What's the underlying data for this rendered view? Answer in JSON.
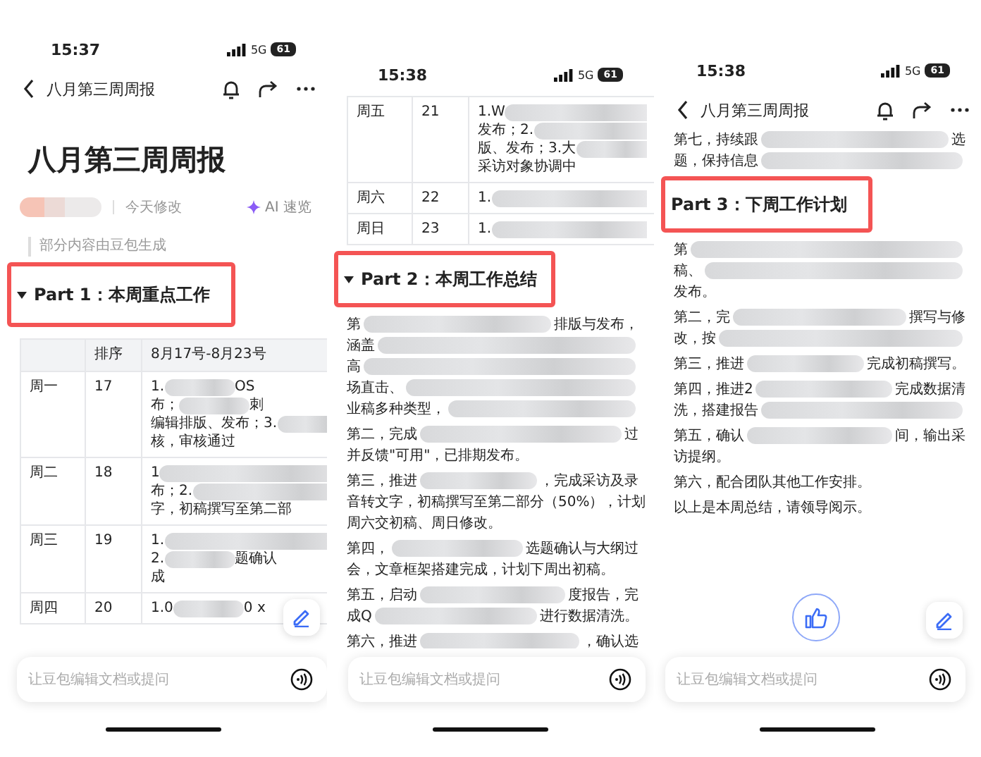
{
  "screens": [
    {
      "status_bar": {
        "time": "15:37",
        "network": "5G",
        "battery": "61"
      },
      "nav_bar": {
        "title": "八月第三周周报"
      },
      "document": {
        "title": "八月第三周周报",
        "modified": "今天修改",
        "ai_button": "AI 速览",
        "note": "部分内容由豆包生成"
      },
      "blocks": [
        {
          "kind": "heading",
          "text": "Part 1：本周重点工作",
          "collapsible": true,
          "highlighted": true
        },
        {
          "kind": "table",
          "columns": [
            "排序",
            "8月17号-8月23号"
          ],
          "rows": [
            {
              "day": "周一",
              "number": "17",
              "lines": [
                [
                  {
                    "kind": "text",
                    "text": "1."
                  },
                  {
                    "kind": "blur"
                  },
                  {
                    "kind": "text",
                    "text": "OS"
                  }
                ],
                [
                  {
                    "kind": "text",
                    "text": "布；"
                  },
                  {
                    "kind": "blur"
                  },
                  {
                    "kind": "text",
                    "text": "刺"
                  }
                ],
                [
                  {
                    "kind": "text",
                    "text": "编辑排版、发布；3."
                  },
                  {
                    "kind": "blur"
                  }
                ],
                [
                  {
                    "kind": "text",
                    "text": "核，审核通过"
                  }
                ]
              ]
            },
            {
              "day": "周二",
              "number": "18",
              "lines": [
                [
                  {
                    "kind": "text",
                    "text": "1"
                  },
                  {
                    "kind": "blur"
                  }
                ],
                [
                  {
                    "kind": "text",
                    "text": "布；2."
                  },
                  {
                    "kind": "blur"
                  }
                ],
                [
                  {
                    "kind": "text",
                    "text": "字，初稿撰写至第二部"
                  }
                ]
              ]
            },
            {
              "day": "周三",
              "number": "19",
              "lines": [
                [
                  {
                    "kind": "text",
                    "text": "1."
                  },
                  {
                    "kind": "blur"
                  }
                ],
                [
                  {
                    "kind": "text",
                    "text": "2."
                  },
                  {
                    "kind": "blur"
                  },
                  {
                    "kind": "text",
                    "text": "题确认"
                  }
                ],
                [
                  {
                    "kind": "text",
                    "text": "成"
                  }
                ]
              ]
            },
            {
              "day": "周四",
              "number": "20",
              "lines": [
                [
                  {
                    "kind": "text",
                    "text": "1.0"
                  },
                  {
                    "kind": "blur"
                  },
                  {
                    "kind": "text",
                    "text": "0 x"
                  }
                ]
              ]
            }
          ]
        }
      ],
      "edit_button": true,
      "input": {
        "placeholder": "让豆包编辑文档或提问"
      }
    },
    {
      "status_bar": {
        "time": "15:38",
        "network": "5G",
        "battery": "61"
      },
      "blocks": [
        {
          "kind": "table",
          "rows": [
            {
              "day": "周五",
              "number": "21",
              "lines": [
                [
                  {
                    "kind": "text",
                    "text": "1.W"
                  },
                  {
                    "kind": "blur"
                  }
                ],
                [
                  {
                    "kind": "text",
                    "text": "发布；2."
                  },
                  {
                    "kind": "blur"
                  }
                ],
                [
                  {
                    "kind": "text",
                    "text": "版、发布；3.大"
                  },
                  {
                    "kind": "blur"
                  }
                ],
                [
                  {
                    "kind": "text",
                    "text": "采访对象协调中"
                  }
                ]
              ]
            },
            {
              "day": "周六",
              "number": "22",
              "lines": [
                [
                  {
                    "kind": "text",
                    "text": "1."
                  },
                  {
                    "kind": "blur"
                  }
                ]
              ]
            },
            {
              "day": "周日",
              "number": "23",
              "lines": [
                [
                  {
                    "kind": "text",
                    "text": "1."
                  },
                  {
                    "kind": "blur"
                  }
                ]
              ]
            }
          ]
        },
        {
          "kind": "heading",
          "text": "Part 2：本周工作总结",
          "collapsible": true,
          "highlighted": true
        },
        {
          "kind": "paragraph",
          "lines": [
            [
              {
                "kind": "text",
                "text": "第"
              },
              {
                "kind": "blur"
              },
              {
                "kind": "text",
                "text": "排版与发布，"
              }
            ],
            [
              {
                "kind": "text",
                "text": "涵盖"
              },
              {
                "kind": "blur"
              }
            ],
            [
              {
                "kind": "text",
                "text": "高"
              },
              {
                "kind": "blur"
              }
            ],
            [
              {
                "kind": "text",
                "text": "场直击、"
              },
              {
                "kind": "blur"
              }
            ],
            [
              {
                "kind": "text",
                "text": "业稿多种类型，"
              },
              {
                "kind": "blur"
              }
            ]
          ]
        },
        {
          "kind": "paragraph",
          "lines": [
            [
              {
                "kind": "text",
                "text": "第二，完成"
              },
              {
                "kind": "blur"
              },
              {
                "kind": "text",
                "text": "过"
              }
            ],
            [
              {
                "kind": "text",
                "text": "并反馈\"可用\"，已排期发布。"
              }
            ]
          ]
        },
        {
          "kind": "paragraph",
          "lines": [
            [
              {
                "kind": "text",
                "text": "第三，推进"
              },
              {
                "kind": "blur"
              },
              {
                "kind": "text",
                "text": "，完成采访及录"
              }
            ],
            [
              {
                "kind": "text",
                "text": "音转文字，初稿撰写至第二部分（50%），计划"
              }
            ],
            [
              {
                "kind": "text",
                "text": "周六交初稿、周日修改。"
              }
            ]
          ]
        },
        {
          "kind": "paragraph",
          "lines": [
            [
              {
                "kind": "text",
                "text": "第四，"
              },
              {
                "kind": "blur"
              },
              {
                "kind": "text",
                "text": "选题确认与大纲过"
              }
            ],
            [
              {
                "kind": "text",
                "text": "会，文章框架搭建完成，计划下周出初稿。"
              }
            ]
          ]
        },
        {
          "kind": "paragraph",
          "lines": [
            [
              {
                "kind": "text",
                "text": "第五，启动"
              },
              {
                "kind": "blur"
              },
              {
                "kind": "text",
                "text": "度报告，完"
              }
            ],
            [
              {
                "kind": "text",
                "text": "成Q"
              },
              {
                "kind": "blur"
              },
              {
                "kind": "text",
                "text": "进行数据清洗。"
              }
            ]
          ]
        },
        {
          "kind": "paragraph",
          "lines": [
            [
              {
                "kind": "text",
                "text": "第六，推进"
              },
              {
                "kind": "blur"
              },
              {
                "kind": "text",
                "text": "，确认选"
              }
            ]
          ]
        }
      ],
      "input": {
        "placeholder": "让豆包编辑文档或提问"
      }
    },
    {
      "status_bar": {
        "time": "15:38",
        "network": "5G",
        "battery": "61"
      },
      "nav_bar": {
        "title": "八月第三周周报"
      },
      "blocks": [
        {
          "kind": "paragraph",
          "lines": [
            [
              {
                "kind": "text",
                "text": "第七，持续跟"
              },
              {
                "kind": "blur"
              },
              {
                "kind": "text",
                "text": "选"
              }
            ],
            [
              {
                "kind": "text",
                "text": "题，保持信息"
              },
              {
                "kind": "blur"
              }
            ]
          ]
        },
        {
          "kind": "heading",
          "text": "Part 3：下周工作计划",
          "collapsible": false,
          "highlighted": true
        },
        {
          "kind": "paragraph",
          "lines": [
            [
              {
                "kind": "text",
                "text": "第"
              },
              {
                "kind": "blur"
              }
            ],
            [
              {
                "kind": "text",
                "text": "稿、"
              },
              {
                "kind": "blur"
              }
            ],
            [
              {
                "kind": "text",
                "text": "发布。"
              }
            ]
          ]
        },
        {
          "kind": "paragraph",
          "lines": [
            [
              {
                "kind": "text",
                "text": "第二，完"
              },
              {
                "kind": "blur"
              },
              {
                "kind": "text",
                "text": "撰写与修"
              }
            ],
            [
              {
                "kind": "text",
                "text": "改，按"
              },
              {
                "kind": "blur"
              }
            ]
          ]
        },
        {
          "kind": "paragraph",
          "lines": [
            [
              {
                "kind": "text",
                "text": "第三，推进"
              },
              {
                "kind": "blur"
              },
              {
                "kind": "text",
                "text": "完成初稿撰写。"
              }
            ]
          ]
        },
        {
          "kind": "paragraph",
          "lines": [
            [
              {
                "kind": "text",
                "text": "第四，推进2"
              },
              {
                "kind": "blur"
              },
              {
                "kind": "text",
                "text": "完成数据清"
              }
            ],
            [
              {
                "kind": "text",
                "text": "洗，搭建报告"
              },
              {
                "kind": "blur"
              }
            ]
          ]
        },
        {
          "kind": "paragraph",
          "lines": [
            [
              {
                "kind": "text",
                "text": "第五，确认"
              },
              {
                "kind": "blur"
              },
              {
                "kind": "text",
                "text": "间，输出采"
              }
            ],
            [
              {
                "kind": "text",
                "text": "访提纲。"
              }
            ]
          ]
        },
        {
          "kind": "paragraph",
          "lines": [
            [
              {
                "kind": "text",
                "text": "第六，配合团队其他工作安排。"
              }
            ]
          ]
        },
        {
          "kind": "paragraph",
          "lines": [
            [
              {
                "kind": "text",
                "text": "以上是本周总结，请领导阅示。"
              }
            ]
          ]
        }
      ],
      "edit_button": true,
      "like_button": true,
      "input": {
        "placeholder": "让豆包编辑文档或提问"
      }
    }
  ]
}
